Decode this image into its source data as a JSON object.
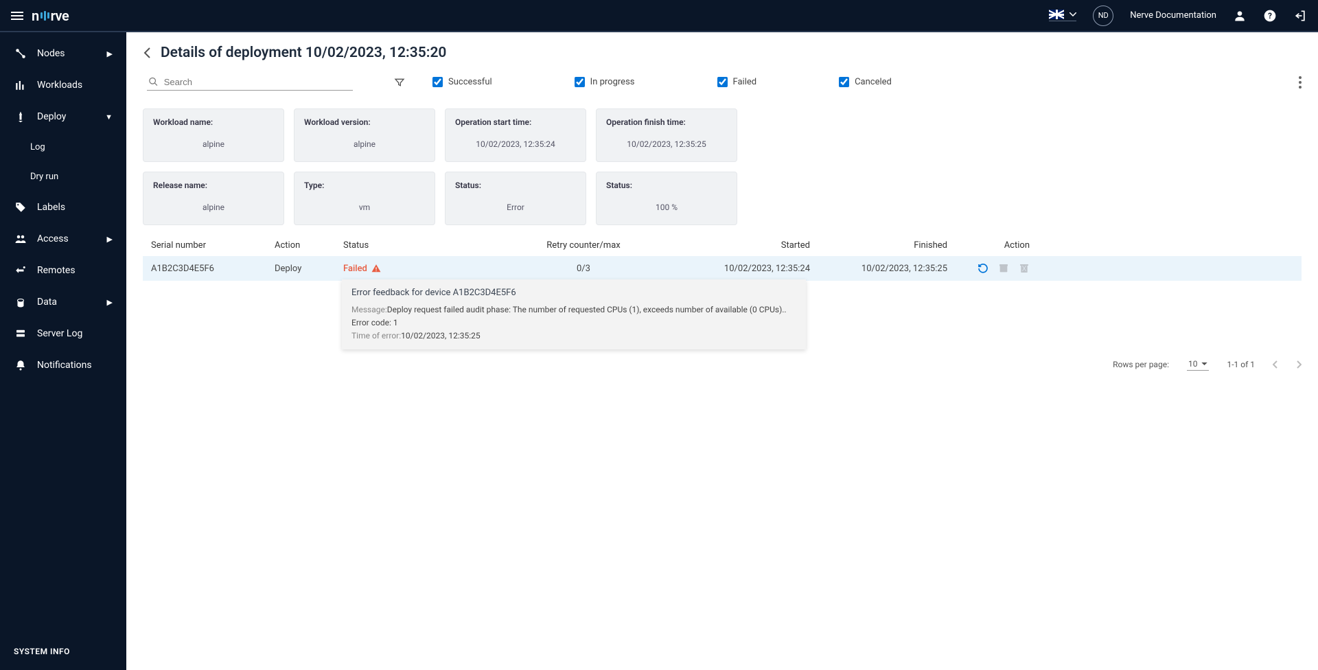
{
  "topbar": {
    "avatar_initials": "ND",
    "username": "Nerve Documentation"
  },
  "sidebar": {
    "items": [
      {
        "label": "Nodes",
        "icon": "nodes"
      },
      {
        "label": "Workloads",
        "icon": "workloads"
      },
      {
        "label": "Deploy",
        "icon": "deploy"
      },
      {
        "label": "Log",
        "sub": true
      },
      {
        "label": "Dry run",
        "sub": true
      },
      {
        "label": "Labels",
        "icon": "labels"
      },
      {
        "label": "Access",
        "icon": "access"
      },
      {
        "label": "Remotes",
        "icon": "remotes"
      },
      {
        "label": "Data",
        "icon": "data"
      },
      {
        "label": "Server Log",
        "icon": "serverlog"
      },
      {
        "label": "Notifications",
        "icon": "notifications"
      }
    ],
    "system_info": "SYSTEM INFO"
  },
  "page": {
    "title": "Details of deployment 10/02/2023, 12:35:20"
  },
  "filters": {
    "search_placeholder": "Search",
    "successful": "Successful",
    "in_progress": "In progress",
    "failed": "Failed",
    "canceled": "Canceled"
  },
  "info_cards_row1": [
    {
      "label": "Workload name:",
      "value": "alpine"
    },
    {
      "label": "Workload version:",
      "value": "alpine"
    },
    {
      "label": "Operation start time:",
      "value": "10/02/2023, 12:35:24"
    },
    {
      "label": "Operation finish time:",
      "value": "10/02/2023, 12:35:25"
    }
  ],
  "info_cards_row2": [
    {
      "label": "Release name:",
      "value": "alpine"
    },
    {
      "label": "Type:",
      "value": "vm"
    },
    {
      "label": "Status:",
      "value": "Error"
    },
    {
      "label": "Status:",
      "value": "100 %"
    }
  ],
  "table": {
    "headers": {
      "serial": "Serial number",
      "action": "Action",
      "status": "Status",
      "retry": "Retry counter/max",
      "started": "Started",
      "finished": "Finished",
      "action2": "Action"
    },
    "row": {
      "serial": "A1B2C3D4E5F6",
      "action": "Deploy",
      "status": "Failed",
      "retry": "0/3",
      "started": "10/02/2023, 12:35:24",
      "finished": "10/02/2023, 12:35:25"
    }
  },
  "tooltip": {
    "title": "Error feedback for device A1B2C3D4E5F6",
    "msg_label": "Message:",
    "msg": "Deploy request failed audit phase: The number of requested CPUs (1), exceeds number of available (0 CPUs).. Error code: 1",
    "time_label": "Time of error:",
    "time": "10/02/2023, 12:35:25"
  },
  "pagination": {
    "rows_label": "Rows per page:",
    "rows_value": "10",
    "range": "1-1 of 1"
  }
}
